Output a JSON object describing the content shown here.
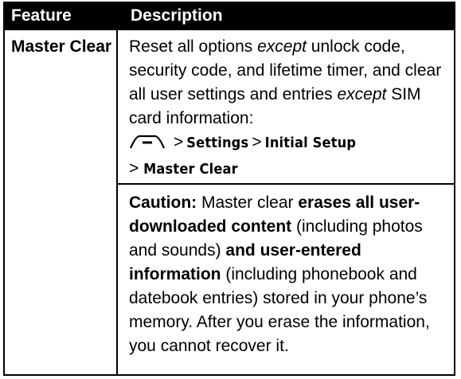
{
  "table": {
    "headers": {
      "feature": "Feature",
      "description": "Description"
    },
    "row": {
      "feature": "Master Clear",
      "desc1": {
        "t1": "Reset all options ",
        "t2": "except",
        "t3": " unlock code, security code, and lifetime timer, and clear all user settings and entries ",
        "t4": "except",
        "t5": " SIM card information:"
      },
      "path": {
        "icon": "menu-key-icon",
        "sep": ">",
        "items": [
          "Settings",
          "Initial Setup",
          "Master Clear"
        ]
      },
      "caution": {
        "label": "Caution:",
        "t1": " Master clear ",
        "b1": "erases all user-downloaded content",
        "t2": " (including photos and sounds) ",
        "b2": "and user-entered information",
        "t3": " (including phonebook and datebook entries) stored in your phone’s memory. After you erase the information, you cannot recover it."
      }
    }
  }
}
